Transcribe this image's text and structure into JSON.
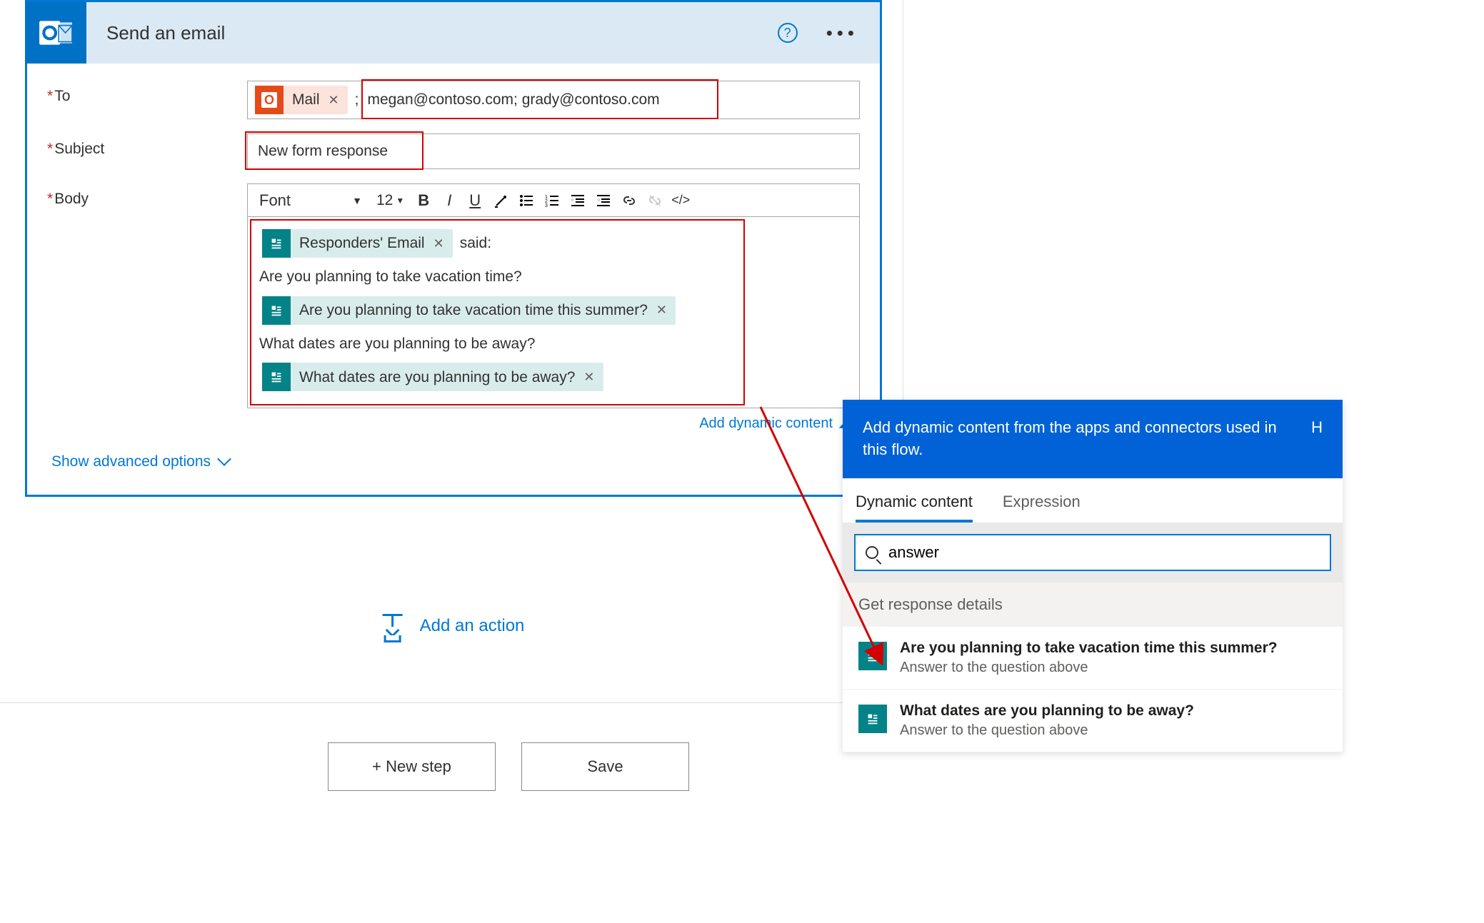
{
  "action_card": {
    "title": "Send an email",
    "fields": {
      "to": {
        "label": "To",
        "token_label": "Mail",
        "value": "megan@contoso.com; grady@contoso.com"
      },
      "subject": {
        "label": "Subject",
        "value": "New form response"
      },
      "body": {
        "label": "Body",
        "font_label": "Font",
        "font_size": "12",
        "token_responders": "Responders' Email",
        "said_text": "said:",
        "q1_text": "Are you planning to take vacation time?",
        "q1_token": "Are you planning to take vacation time this summer?",
        "q2_text": "What dates are you planning to be away?",
        "q2_token": "What dates are you planning to be away?"
      }
    },
    "add_dynamic": "Add dynamic content",
    "advanced": "Show advanced options"
  },
  "add_action": "Add an action",
  "buttons": {
    "new_step": "+ New step",
    "save": "Save"
  },
  "dc_panel": {
    "header": "Add dynamic content from the apps and connectors used in this flow.",
    "header_help": "H",
    "tab_dynamic": "Dynamic content",
    "tab_expression": "Expression",
    "search_value": "answer",
    "section": "Get response details",
    "items": [
      {
        "title": "Are you planning to take vacation time this summer?",
        "sub": "Answer to the question above"
      },
      {
        "title": "What dates are you planning to be away?",
        "sub": "Answer to the question above"
      }
    ]
  }
}
